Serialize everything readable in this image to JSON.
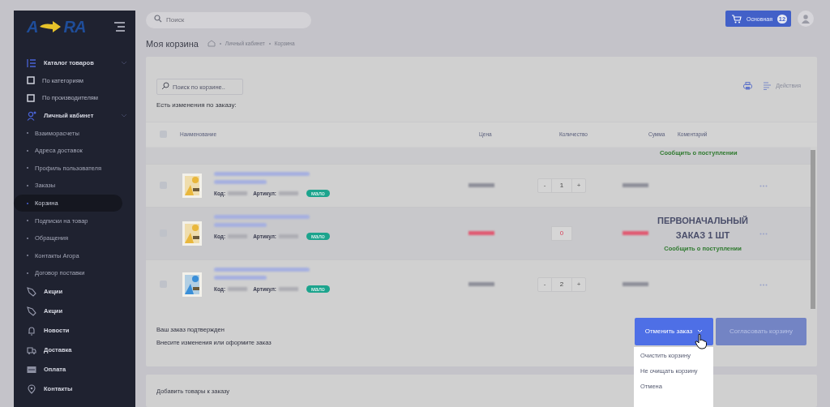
{
  "logo": {
    "left": "A",
    "right": "RA"
  },
  "sidebar": {
    "items": [
      {
        "kind": "section",
        "label": "Каталог товаров",
        "expanded": true,
        "selected": false
      },
      {
        "kind": "check",
        "label": "По категориям",
        "selected": false
      },
      {
        "kind": "check",
        "label": "По производителям",
        "selected": false
      },
      {
        "kind": "section",
        "label": "Личный кабинет",
        "expanded": true,
        "selected": false
      },
      {
        "kind": "sub",
        "label": "Взаиморасчеты",
        "selected": false
      },
      {
        "kind": "sub",
        "label": "Адреса доставок",
        "selected": false
      },
      {
        "kind": "sub",
        "label": "Профиль пользователя",
        "selected": false
      },
      {
        "kind": "sub",
        "label": "Заказы",
        "selected": false
      },
      {
        "kind": "sub",
        "label": "Корзина",
        "selected": true
      },
      {
        "kind": "sub",
        "label": "Подписки на товар",
        "selected": false
      },
      {
        "kind": "sub",
        "label": "Обращения",
        "selected": false
      },
      {
        "kind": "sub",
        "label": "Контакты Агора",
        "selected": false
      },
      {
        "kind": "sub",
        "label": "Договор поставки",
        "selected": false
      },
      {
        "kind": "link",
        "label": "Акции",
        "selected": false
      },
      {
        "kind": "link",
        "label": "Акции",
        "selected": false
      },
      {
        "kind": "link",
        "label": "Новости",
        "selected": false
      },
      {
        "kind": "link",
        "label": "Доставка",
        "selected": false
      },
      {
        "kind": "link",
        "label": "Оплата",
        "selected": false
      },
      {
        "kind": "link",
        "label": "Контакты",
        "selected": false
      }
    ]
  },
  "topbar": {
    "search": {
      "placeholder": "Поиск"
    },
    "cart_button": {
      "label": "Основная",
      "count": "12"
    }
  },
  "page": {
    "title": "Моя корзина",
    "breadcrumbs": [
      "Личный кабинет",
      "Корзина"
    ]
  },
  "cart": {
    "search": {
      "placeholder": "Поиск по корзине.."
    },
    "actions_label": "Действия",
    "notice": "Есть изменения по заказу:",
    "columns": [
      "Наименование",
      "Цена",
      "Количество",
      "Сумма",
      "Коментарий"
    ],
    "header_checked": false,
    "partial_row": {
      "notify": "Сообщить о поступлении"
    },
    "rows": [
      {
        "checked": false,
        "code_label": "Код:",
        "article_label": "Артикул:",
        "badge": "мало",
        "unavailable": false,
        "quantity": "1",
        "minus": "-",
        "plus": "+"
      },
      {
        "checked": false,
        "code_label": "Код:",
        "article_label": "Артикул:",
        "badge": "мало",
        "unavailable": true,
        "quantity": "0",
        "comment": "ПЕРВОНАЧАЛЬНЫЙ ЗАКАЗ 1 ШТ",
        "notify": "Сообщить о поступлении"
      },
      {
        "checked": false,
        "code_label": "Код:",
        "article_label": "Артикул:",
        "badge": "мало",
        "unavailable": false,
        "quantity": "2",
        "minus": "-",
        "plus": "+"
      }
    ],
    "status_lines": [
      "Ваш заказ подтвержден",
      "Внесите изменения или оформите заказ"
    ],
    "cancel_button": "Отменить заказ",
    "approve_button": "Согласовать корзину",
    "dropdown": [
      "Очистить корзину",
      "Не очищать корзину",
      "Отмена"
    ]
  },
  "add_card": {
    "title": "Добавить товары к заказу"
  }
}
